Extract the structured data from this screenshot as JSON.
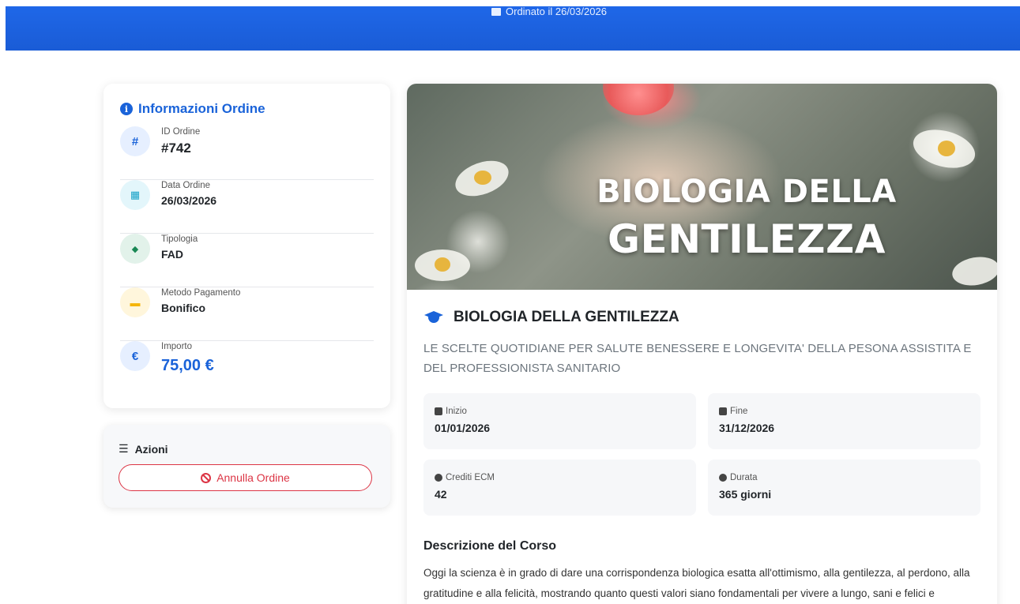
{
  "header": {
    "order_date_text": "Ordinato il 26/03/2026"
  },
  "info_card": {
    "title": "Informazioni Ordine",
    "rows": [
      {
        "label": "ID Ordine",
        "value": "#742",
        "icon": "hash-icon",
        "icon_glyph": "#"
      },
      {
        "label": "Data Ordine",
        "value": "26/03/2026",
        "icon": "calendar-icon",
        "icon_glyph": "▦"
      },
      {
        "label": "Tipologia",
        "value": "FAD",
        "icon": "tag-icon",
        "icon_glyph": "◆"
      },
      {
        "label": "Metodo Pagamento",
        "value": "Bonifico",
        "icon": "credit-card-icon",
        "icon_glyph": "▬"
      },
      {
        "label": "Importo",
        "value": "75,00 €",
        "icon": "euro-icon",
        "icon_glyph": "€"
      }
    ]
  },
  "actions": {
    "title": "Azioni",
    "cancel_label": "Annulla Ordine"
  },
  "course": {
    "banner_line1": "BIOLOGIA DELLA",
    "banner_line2": "GENTILEZZA",
    "title": "BIOLOGIA DELLA GENTILEZZA",
    "subtitle": "LE SCELTE QUOTIDIANE PER SALUTE BENESSERE E LONGEVITA' DELLA PESONA ASSISTITA E DEL PROFESSIONISTA SANITARIO",
    "stats": {
      "start_label": "Inizio",
      "start_value": "01/01/2026",
      "end_label": "Fine",
      "end_value": "31/12/2026",
      "credits_label": "Crediti ECM",
      "credits_value": "42",
      "duration_label": "Durata",
      "duration_value": "365 giorni"
    },
    "description_title": "Descrizione del Corso",
    "description": "Oggi la scienza è in grado di dare una corrispondenza biologica esatta all'ottimismo, alla gentilezza, al perdono, alla gratitudine e alla felicità, mostrando quanto questi valori siano fondamentali per vivere a lungo, sani e felici e"
  },
  "colors": {
    "primary": "#1a63d9",
    "danger": "#dc3545",
    "hash_bg": "#e6efff",
    "calendar_bg": "#e3f6fb",
    "tag_bg": "#e2f2ea",
    "card_bg": "#fff6dc",
    "euro_bg": "#e6efff"
  }
}
